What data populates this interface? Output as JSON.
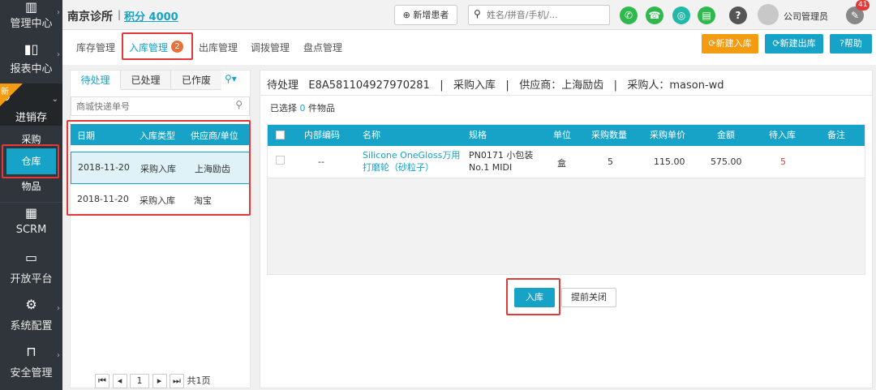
{
  "sidebar": {
    "items": [
      {
        "label": "管理中心",
        "icon": "book-icon"
      },
      {
        "label": "报表中心",
        "icon": "bar-chart-icon"
      },
      {
        "label": "进销存",
        "icon": "globe-icon",
        "badge": "新"
      },
      {
        "label": "SCRM",
        "icon": "grid-icon"
      },
      {
        "label": "开放平台",
        "icon": "monitor-icon"
      },
      {
        "label": "系统配置",
        "icon": "gear-icon"
      },
      {
        "label": "安全管理",
        "icon": "lock-icon"
      }
    ],
    "sub_items": [
      "采购",
      "仓库",
      "物品"
    ]
  },
  "header": {
    "clinic": "南京诊所",
    "points": "积分 4000",
    "new_patient": "新增患者",
    "search_placeholder": "姓名/拼音/手机/...",
    "user": "公司管理员",
    "notif_count": "41"
  },
  "tabs": [
    {
      "label": "库存管理"
    },
    {
      "label": "入库管理",
      "badge": "2",
      "active": true
    },
    {
      "label": "出库管理"
    },
    {
      "label": "调拨管理"
    },
    {
      "label": "盘点管理"
    }
  ],
  "actions": {
    "new_in": "新建入库",
    "new_out": "新建出库",
    "help": "帮助"
  },
  "left": {
    "subtabs": [
      "待处理",
      "已处理",
      "已作废"
    ],
    "search_placeholder": "商城快递单号",
    "columns": [
      "日期",
      "入库类型",
      "供应商/单位"
    ],
    "rows": [
      {
        "date": "2018-11-20",
        "type": "采购入库",
        "supplier": "上海励齿"
      },
      {
        "date": "2018-11-20",
        "type": "采购入库",
        "supplier": "淘宝"
      }
    ],
    "pager": {
      "page": "1",
      "total": "共1页"
    }
  },
  "right": {
    "header": "待处理   E8A581104927970281   |   采购入库   |   供应商：上海励齿   |   采购人：mason-wd",
    "selected_prefix": "已选择",
    "selected_count": "0",
    "selected_suffix": "件物品",
    "columns": [
      "内部编码",
      "名称",
      "规格",
      "单位",
      "采购数量",
      "采购单价",
      "金额",
      "待入库",
      "备注"
    ],
    "rows": [
      {
        "code": "--",
        "name": "Silicone OneGloss万用打磨轮（砂粒子）",
        "spec": "PN0171 小包装 No.1 MIDI",
        "unit": "盒",
        "qty": "5",
        "price": "115.00",
        "amount": "575.00",
        "pending": "5",
        "note": ""
      }
    ],
    "btn_in": "入库",
    "btn_close": "提前关闭"
  },
  "colors": {
    "teal": "#17a2c7",
    "sidebar": "#2f353b",
    "orange": "#f39c12",
    "red": "#e03a3a"
  }
}
